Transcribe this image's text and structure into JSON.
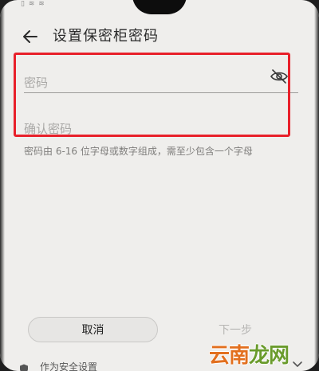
{
  "status_bar": {
    "icons": [
      "sim-icon",
      "wifi-icon",
      "nfc-icon"
    ],
    "icon_text": "▯ ≋ ≋"
  },
  "header": {
    "back_icon": "arrow-left-icon",
    "title": "设置保密柜密码"
  },
  "form": {
    "password_placeholder": "密码",
    "password_value": "",
    "password_visibility_icon": "eye-off-icon",
    "confirm_placeholder": "确认密码",
    "confirm_value": "",
    "hint": "密码由 6-16 位字母或数字组成，需至少包含一个字母"
  },
  "buttons": {
    "cancel_label": "取消",
    "next_label": "下一步"
  },
  "bottom": {
    "label": "作为安全设置",
    "icon": "shield-icon"
  },
  "watermark": {
    "part1": "云南",
    "part2": "龙网"
  },
  "colors": {
    "background": "#efeeec",
    "highlight": "#e8202a",
    "text_primary": "#2b2b2b",
    "text_placeholder": "#a9a8a6",
    "disabled": "#b7b6b4",
    "watermark_orange": "#e26f1e",
    "watermark_green": "#6a9b2c"
  }
}
